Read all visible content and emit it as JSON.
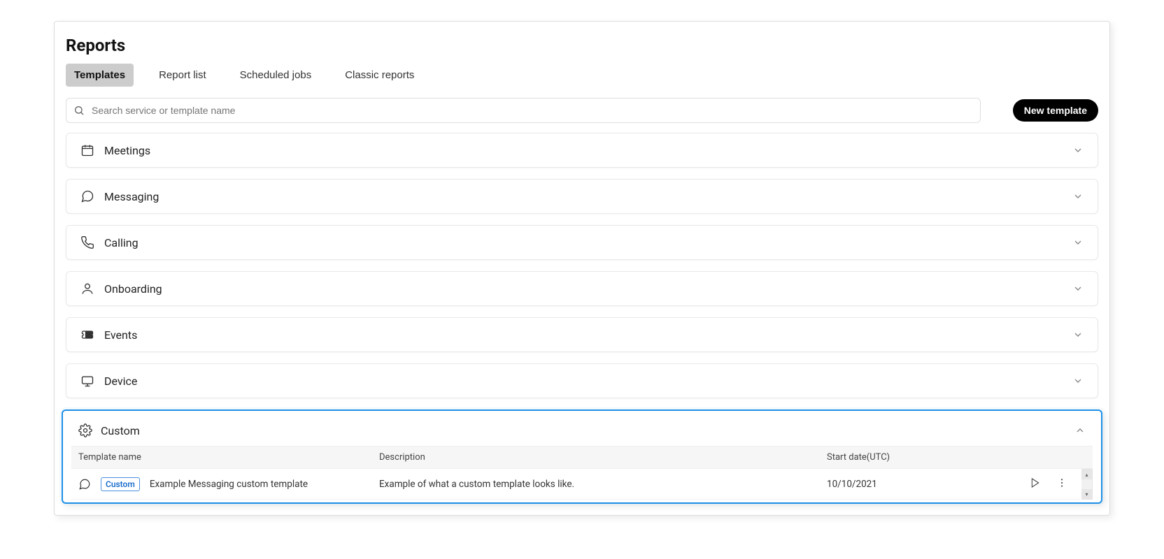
{
  "page": {
    "title": "Reports"
  },
  "tabs": {
    "items": [
      {
        "label": "Templates",
        "active": true
      },
      {
        "label": "Report list",
        "active": false
      },
      {
        "label": "Scheduled jobs",
        "active": false
      },
      {
        "label": "Classic reports",
        "active": false
      }
    ]
  },
  "search": {
    "placeholder": "Search service or template name"
  },
  "buttons": {
    "new_template": "New template"
  },
  "sections": {
    "items": [
      {
        "label": "Meetings",
        "icon": "calendar-icon"
      },
      {
        "label": "Messaging",
        "icon": "message-icon"
      },
      {
        "label": "Calling",
        "icon": "phone-icon"
      },
      {
        "label": "Onboarding",
        "icon": "person-icon"
      },
      {
        "label": "Events",
        "icon": "ticket-icon"
      },
      {
        "label": "Device",
        "icon": "device-icon"
      }
    ]
  },
  "custom": {
    "label": "Custom",
    "table": {
      "headers": {
        "name": "Template name",
        "desc": "Description",
        "date": "Start date(UTC)"
      },
      "rows": [
        {
          "tag": "Custom",
          "name": "Example Messaging custom template",
          "desc": "Example of what a custom template looks like.",
          "date": "10/10/2021"
        }
      ]
    }
  }
}
